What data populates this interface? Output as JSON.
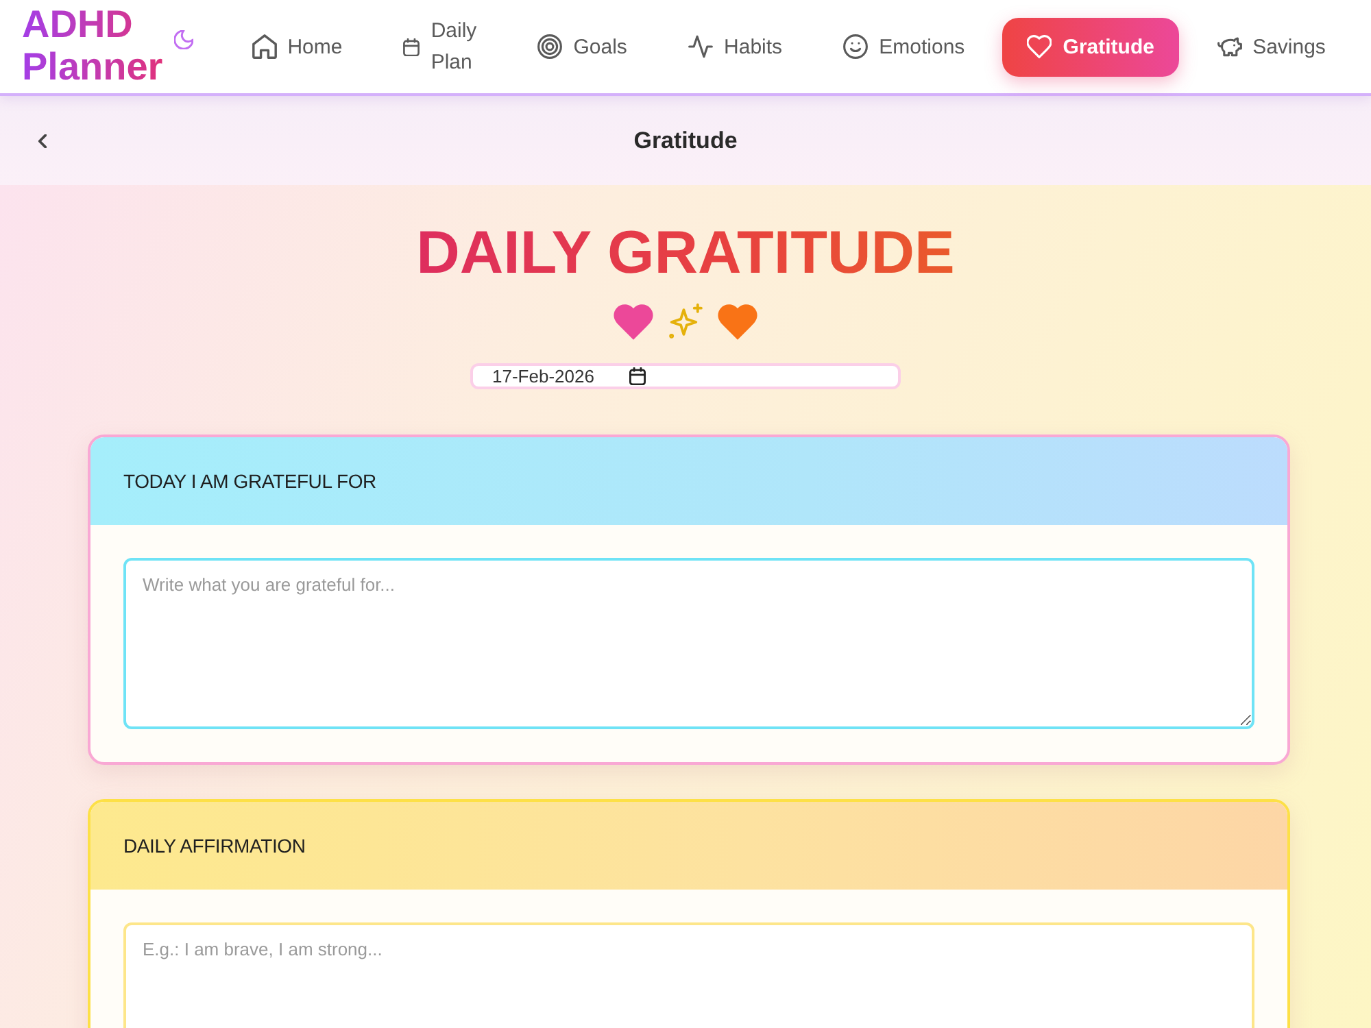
{
  "header": {
    "logo": "ADHD Planner",
    "nav": [
      {
        "label": "Home",
        "selected": false
      },
      {
        "label": "Daily Plan",
        "selected": false
      },
      {
        "label": "Goals",
        "selected": false
      },
      {
        "label": "Habits",
        "selected": false
      },
      {
        "label": "Emotions",
        "selected": false
      },
      {
        "label": "Gratitude",
        "selected": true
      },
      {
        "label": "Savings",
        "selected": false
      }
    ]
  },
  "subheader": {
    "title": "Gratitude"
  },
  "page": {
    "title": "DAILY GRATITUDE",
    "date": "17-Feb-2026"
  },
  "sections": [
    {
      "title": "TODAY I AM GRATEFUL FOR",
      "placeholder": "Write what you are grateful for..."
    },
    {
      "title": "DAILY AFFIRMATION",
      "placeholder": "E.g.: I am brave, I am strong..."
    }
  ]
}
